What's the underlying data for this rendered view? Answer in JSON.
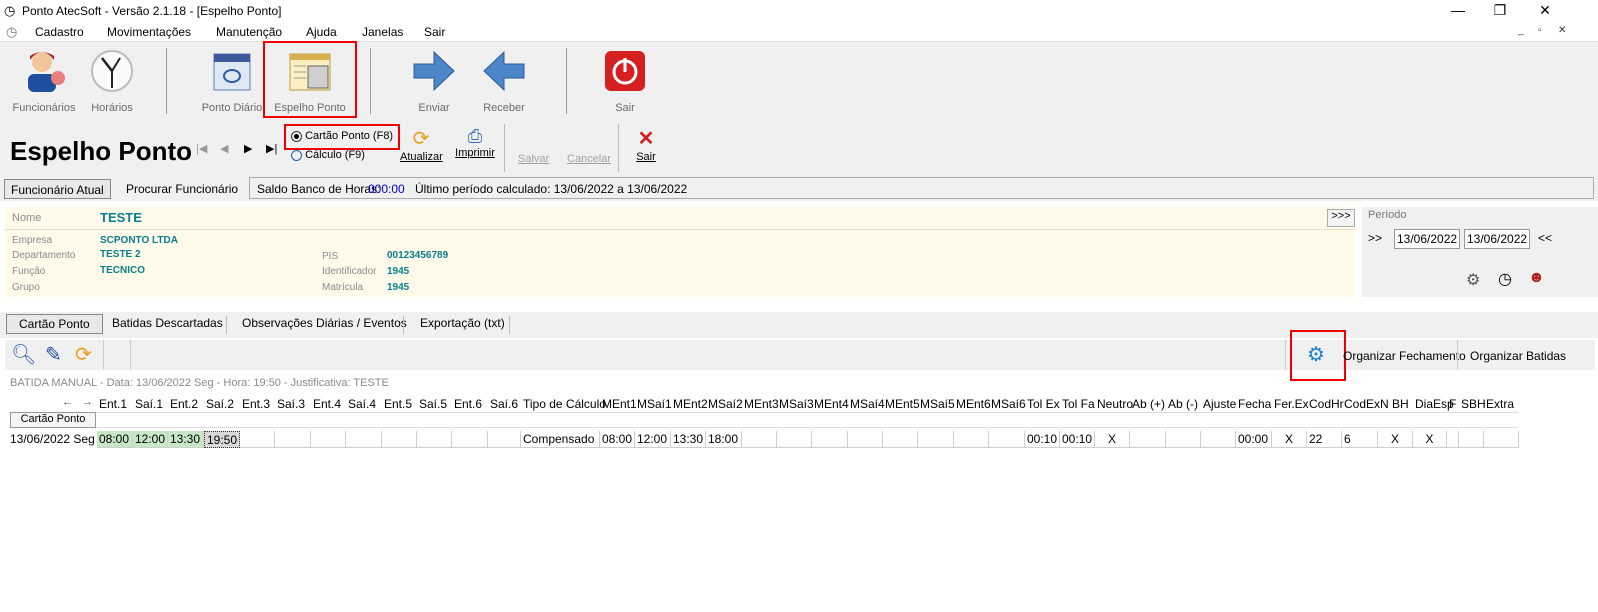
{
  "window": {
    "title": "Ponto AtecSoft - Versão 2.1.18 - [Espelho Ponto]",
    "min": "—",
    "max": "❐",
    "close": "✕"
  },
  "menu": [
    "Cadastro",
    "Movimentações",
    "Manutenção",
    "Ajuda",
    "Janelas",
    "Sair"
  ],
  "toolbar": {
    "funcionarios": "Funcionários",
    "horarios": "Horários",
    "ponto_diario": "Ponto Diário",
    "espelho_ponto": "Espelho Ponto",
    "enviar": "Enviar",
    "receber": "Receber",
    "sair": "Sair"
  },
  "header": {
    "title": "Espelho Ponto",
    "radio_cartao": "Cartão Ponto (F8)",
    "radio_calculo": "Cálculo (F9)",
    "atualizar": "Atualizar",
    "imprimir": "Imprimir",
    "salvar": "Salvar",
    "cancelar": "Cancelar",
    "sair": "Sair"
  },
  "tabs": {
    "funcionario_atual": "Funcionário Atual",
    "procurar": "Procurar Funcionário",
    "saldo_label": "Saldo Banco de Horas:",
    "saldo_value": "000:00",
    "ultimo_periodo": "Último período calculado: 13/06/2022 a 13/06/2022"
  },
  "employee": {
    "nome_label": "Nome",
    "nome": "TESTE",
    "expand": ">>>",
    "empresa_label": "Empresa",
    "empresa": "SCPONTO LTDA",
    "departamento_label": "Departamento",
    "departamento": "TESTE 2",
    "funcao_label": "Função",
    "funcao": "TECNICO",
    "grupo_label": "Grupo",
    "pis_label": "PIS",
    "pis": "00123456789",
    "identificador_label": "Identificador",
    "identificador": "1945",
    "matricula_label": "Matrícula",
    "matricula": "1945"
  },
  "periodo": {
    "label": "Período",
    "prev": ">>",
    "start": "13/06/2022",
    "end": "13/06/2022",
    "next": "<<"
  },
  "subtabs": [
    "Cartão Ponto",
    "Batidas Descartadas",
    "Observações Diárias / Eventos",
    "Exportação (txt)"
  ],
  "actions": {
    "organizar_fechamento": "Organizar Fechamento",
    "organizar_batidas": "Organizar Batidas"
  },
  "status_line": "BATIDA MANUAL - Data: 13/06/2022 Seg - Hora: 19:50 - Justificativa: TESTE",
  "grid": {
    "nav_prev": "←",
    "nav_next": "→",
    "section_label": "Cartão Ponto",
    "columns": [
      "Ent.1",
      "Saí.1",
      "Ent.2",
      "Saí.2",
      "Ent.3",
      "Saí.3",
      "Ent.4",
      "Saí.4",
      "Ent.5",
      "Saí.5",
      "Ent.6",
      "Saí.6",
      "Tipo de Cálculo",
      "MEnt1",
      "MSaí1",
      "MEnt2",
      "MSaí2",
      "MEnt3",
      "MSaí3",
      "MEnt4",
      "MSaí4",
      "MEnt5",
      "MSaí5",
      "MEnt6",
      "MSaí6",
      "Tol Ex",
      "Tol Fa",
      "Neutro",
      "Ab (+)",
      "Ab (-)",
      "Ajuste",
      "Fecha",
      "Fer.Ex",
      "CodHr",
      "CodEx",
      "N BH",
      "DiaEsp",
      "F",
      "SBH",
      "Extra"
    ],
    "row": {
      "date": "13/06/2022 Seg",
      "ent1": "08:00",
      "sai1": "12:00",
      "ent2": "13:30",
      "sai2": "19:50",
      "tipo": "Compensado",
      "ment1": "08:00",
      "msai1": "12:00",
      "ment2": "13:30",
      "msai2": "18:00",
      "tolex": "00:10",
      "tolfa": "00:10",
      "neutro": "X",
      "fecha": "00:00",
      "ferex": "X",
      "codhr": "22",
      "codex": "6",
      "nbh": "X",
      "diaesp": "X"
    }
  }
}
